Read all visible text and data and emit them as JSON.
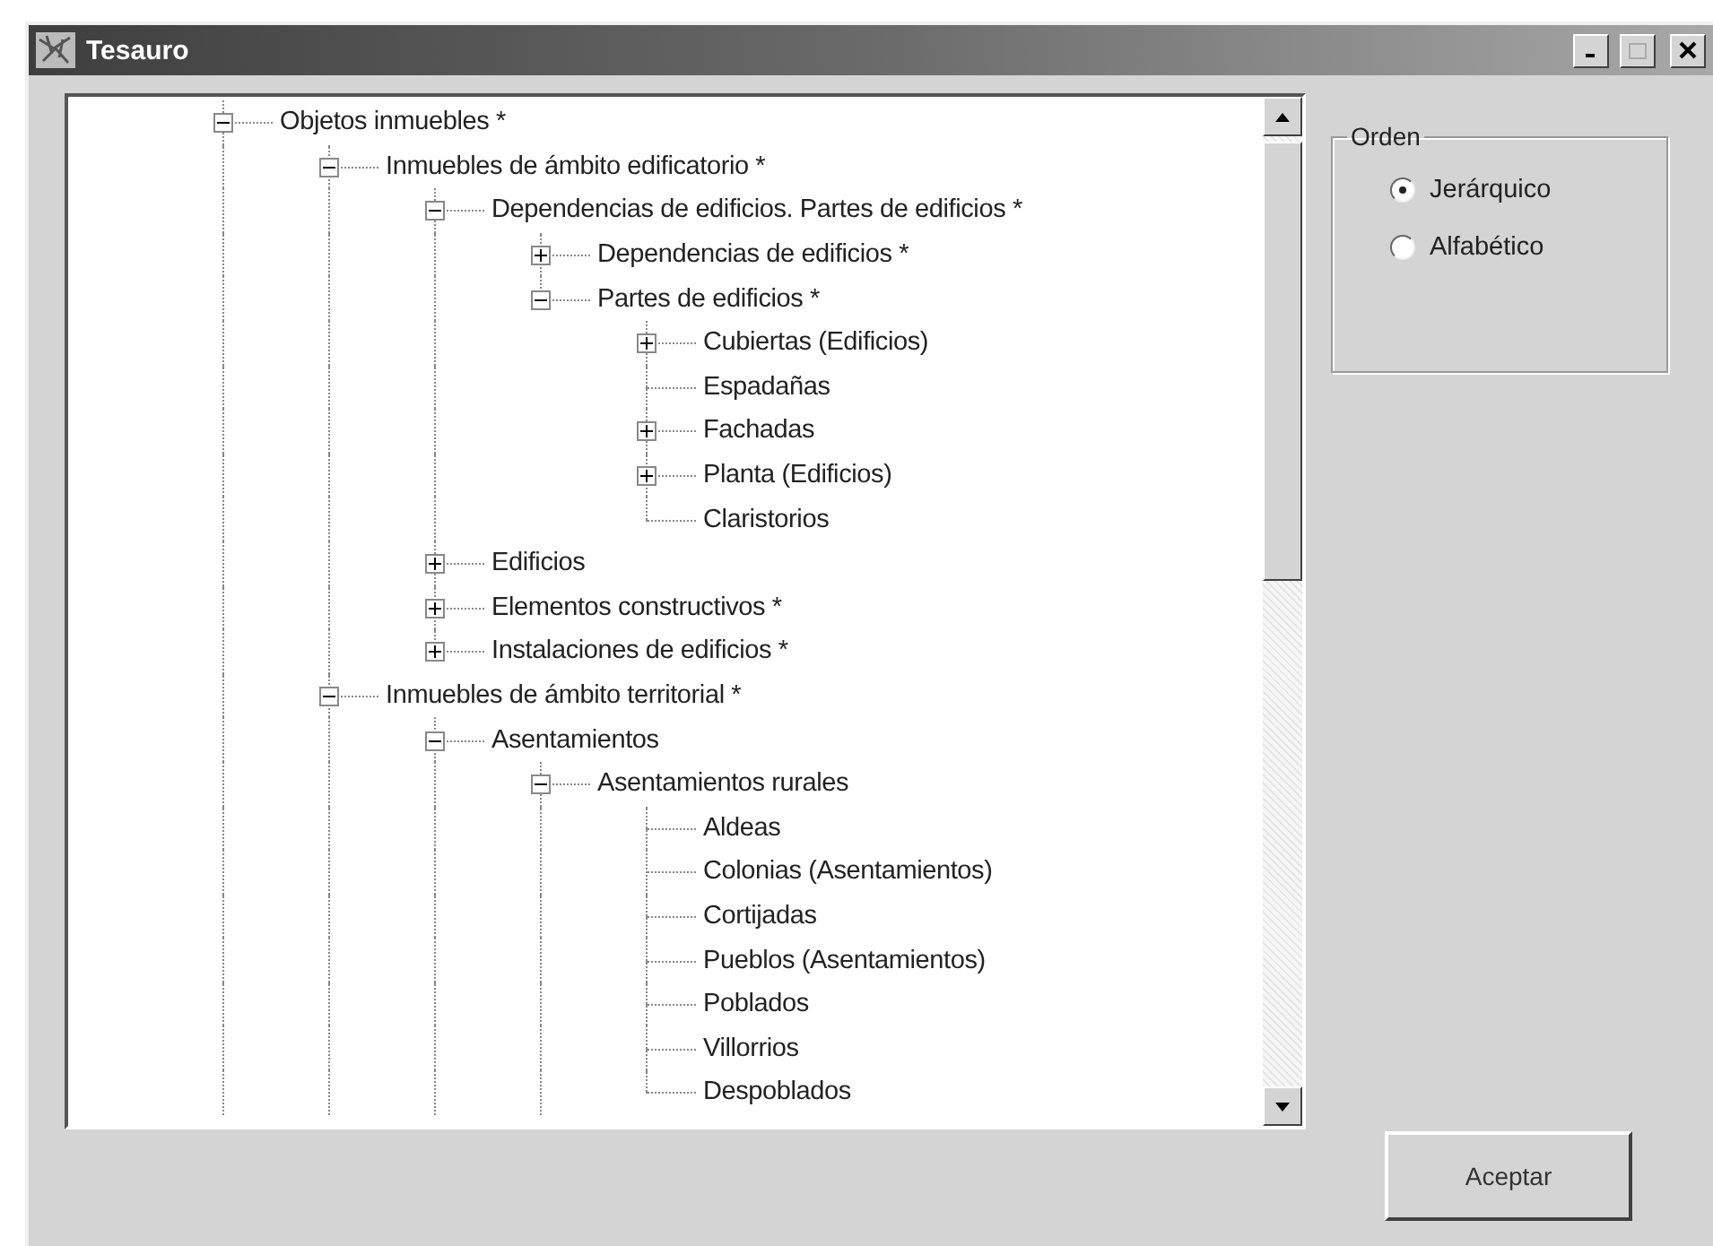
{
  "window": {
    "title": "Tesauro"
  },
  "tree": [
    {
      "label": "Objetos inmuebles *",
      "expanded": true,
      "children": [
        {
          "label": "Inmuebles de ámbito edificatorio *",
          "expanded": true,
          "children": [
            {
              "label": "Dependencias de edificios. Partes de edificios *",
              "expanded": true,
              "children": [
                {
                  "label": "Dependencias de edificios *",
                  "expanded": false
                },
                {
                  "label": "Partes de edificios *",
                  "expanded": true,
                  "children": [
                    {
                      "label": "Cubiertas (Edificios)",
                      "expanded": false
                    },
                    {
                      "label": "Espadañas"
                    },
                    {
                      "label": "Fachadas",
                      "expanded": false
                    },
                    {
                      "label": "Planta (Edificios)",
                      "expanded": false
                    },
                    {
                      "label": "Claristorios"
                    }
                  ]
                }
              ]
            },
            {
              "label": "Edificios",
              "expanded": false
            },
            {
              "label": "Elementos constructivos *",
              "expanded": false
            },
            {
              "label": "Instalaciones de edificios *",
              "expanded": false
            }
          ]
        },
        {
          "label": "Inmuebles de ámbito territorial *",
          "expanded": true,
          "children": [
            {
              "label": "Asentamientos",
              "expanded": true,
              "children": [
                {
                  "label": "Asentamientos rurales",
                  "expanded": true,
                  "children": [
                    {
                      "label": "Aldeas"
                    },
                    {
                      "label": "Colonias (Asentamientos)"
                    },
                    {
                      "label": "Cortijadas"
                    },
                    {
                      "label": "Pueblos (Asentamientos)"
                    },
                    {
                      "label": "Poblados"
                    },
                    {
                      "label": "Villorrios"
                    },
                    {
                      "label": "Despoblados"
                    }
                  ]
                }
              ]
            }
          ]
        }
      ]
    }
  ],
  "order": {
    "title": "Orden",
    "options": [
      {
        "label": "Jerárquico",
        "selected": true
      },
      {
        "label": "Alfabético",
        "selected": false
      }
    ]
  },
  "buttons": [
    "Aceptar"
  ]
}
